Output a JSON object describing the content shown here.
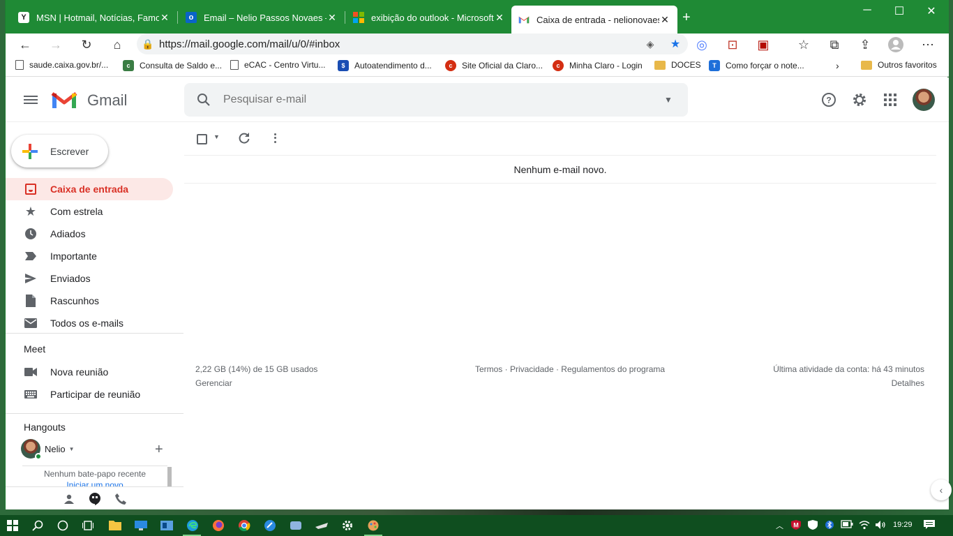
{
  "browser": {
    "tabs": [
      {
        "title": "MSN | Hotmail, Notícias, Famosos",
        "active": false
      },
      {
        "title": "Email – Nelio Passos Novaes – Outlook",
        "active": false
      },
      {
        "title": "exibição do outlook - Microsoft",
        "active": false
      },
      {
        "title": "Caixa de entrada - nelionovaes@",
        "active": true
      }
    ],
    "new_tab": "+",
    "url": "https://mail.google.com/mail/u/0/#inbox",
    "bookmarks": [
      {
        "label": "saude.caixa.gov.br/..."
      },
      {
        "label": "Consulta de Saldo e..."
      },
      {
        "label": "eCAC - Centro Virtu..."
      },
      {
        "label": "Autoatendimento d..."
      },
      {
        "label": "Site Oficial da Claro..."
      },
      {
        "label": "Minha Claro - Login"
      },
      {
        "label": "DOCES"
      },
      {
        "label": "Como forçar o note..."
      }
    ],
    "other_bookmarks": "Outros favoritos"
  },
  "gmail": {
    "wordmark": "Gmail",
    "search_placeholder": "Pesquisar e-mail",
    "compose_label": "Escrever",
    "nav": [
      {
        "label": "Caixa de entrada",
        "icon": "inbox-icon",
        "active": true
      },
      {
        "label": "Com estrela",
        "icon": "star-icon"
      },
      {
        "label": "Adiados",
        "icon": "clock-icon"
      },
      {
        "label": "Importante",
        "icon": "important-icon"
      },
      {
        "label": "Enviados",
        "icon": "send-icon"
      },
      {
        "label": "Rascunhos",
        "icon": "draft-icon"
      },
      {
        "label": "Todos os e-mails",
        "icon": "mail-icon"
      }
    ],
    "meet": {
      "title": "Meet",
      "items": [
        {
          "label": "Nova reunião",
          "icon": "video-icon"
        },
        {
          "label": "Participar de reunião",
          "icon": "keyboard-icon"
        }
      ]
    },
    "hangouts": {
      "title": "Hangouts",
      "user": "Nelio",
      "empty": "Nenhum bate-papo recente",
      "start": "Iniciar um novo"
    },
    "empty_message": "Nenhum e-mail novo.",
    "footer": {
      "storage": "2,22 GB (14%) de 15 GB usados",
      "manage": "Gerenciar",
      "links": "Termos · Privacidade · Regulamentos do programa",
      "activity": "Última atividade da conta: há 43 minutos",
      "details": "Detalhes"
    }
  },
  "taskbar": {
    "clock": "19:29"
  },
  "colors": {
    "browser_frame": "#1f8a35",
    "gmail_red": "#d93025",
    "active_nav_bg": "#fce8e6",
    "taskbar": "#0f4e1f"
  }
}
